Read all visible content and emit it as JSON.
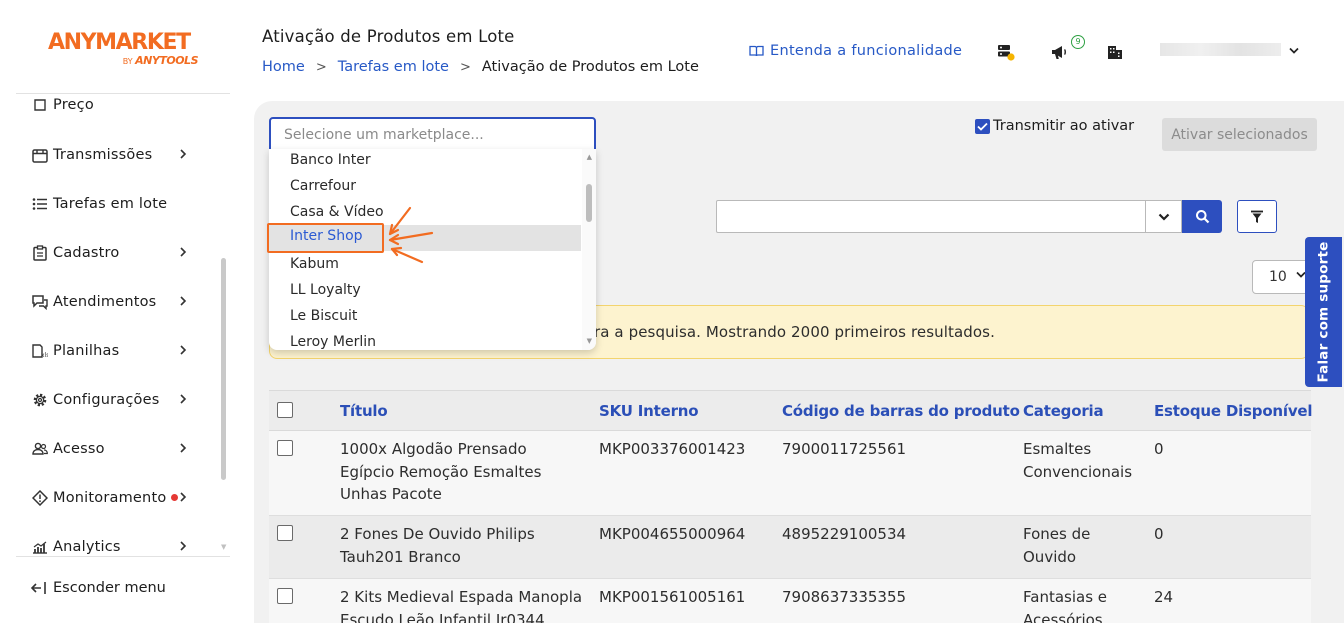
{
  "brand": {
    "logo_main": "ANYMARKET",
    "logo_by": "BY",
    "logo_sub": "ANYTOOLS",
    "accent": "#f26c21",
    "primary": "#2d4fbf"
  },
  "sidebar": {
    "items": [
      {
        "label": "Preço",
        "icon": "price-icon",
        "chevron": false
      },
      {
        "label": "Transmissões",
        "icon": "transmission-icon",
        "chevron": true
      },
      {
        "label": "Tarefas em lote",
        "icon": "list-icon",
        "chevron": false
      },
      {
        "label": "Cadastro",
        "icon": "clipboard-icon",
        "chevron": true
      },
      {
        "label": "Atendimentos",
        "icon": "chat-icon",
        "chevron": true
      },
      {
        "label": "Planilhas",
        "icon": "spreadsheet-icon",
        "chevron": true
      },
      {
        "label": "Configurações",
        "icon": "gear-icon",
        "chevron": true
      },
      {
        "label": "Acesso",
        "icon": "users-icon",
        "chevron": true
      },
      {
        "label": "Monitoramento",
        "icon": "diamond-icon",
        "chevron": true
      },
      {
        "label": "Analytics",
        "icon": "chart-icon",
        "chevron": true
      }
    ],
    "hide_menu": "Esconder menu"
  },
  "header": {
    "title": "Ativação de Produtos em Lote",
    "breadcrumb": [
      "Home",
      "Tarefas em lote",
      "Ativação de Produtos em Lote"
    ],
    "help_link": "Entenda a funcionalidade",
    "notification_count": "9"
  },
  "marketplace": {
    "placeholder": "Selecione um marketplace...",
    "options": [
      "Banco Inter",
      "Carrefour",
      "Casa & Vídeo",
      "Inter Shop",
      "Kabum",
      "LL Loyalty",
      "Le Biscuit",
      "Leroy Merlin"
    ],
    "selected": "Inter Shop"
  },
  "toolbar": {
    "transmit_label": "Transmitir ao ativar",
    "transmit_checked": true,
    "activate_label": "Ativar selecionados",
    "page_size": "10"
  },
  "alert": {
    "text": "ra a pesquisa. Mostrando 2000 primeiros resultados."
  },
  "support_tab": "Falar com suporte",
  "table": {
    "columns": [
      "Título",
      "SKU Interno",
      "Código de barras do produto",
      "Categoria",
      "Estoque Disponível"
    ],
    "rows": [
      {
        "title": [
          "1000x Algodão Prensado",
          "Egípcio Remoção Esmaltes",
          "Unhas Pacote"
        ],
        "sku": "MKP003376001423",
        "barcode": "7900011725561",
        "category": [
          "Esmaltes",
          "Convencionais"
        ],
        "stock": "0"
      },
      {
        "title": [
          "2 Fones De Ouvido Philips",
          "Tauh201 Branco"
        ],
        "sku": "MKP004655000964",
        "barcode": "4895229100534",
        "category": [
          "Fones de",
          "Ouvido"
        ],
        "stock": "0"
      },
      {
        "title": [
          "2 Kits Medieval Espada Manopla",
          "Escudo Leão Infantil Jr0344"
        ],
        "sku": "MKP001561005161",
        "barcode": "7908637335355",
        "category": [
          "Fantasias e",
          "Acessórios"
        ],
        "stock": "24"
      }
    ]
  }
}
